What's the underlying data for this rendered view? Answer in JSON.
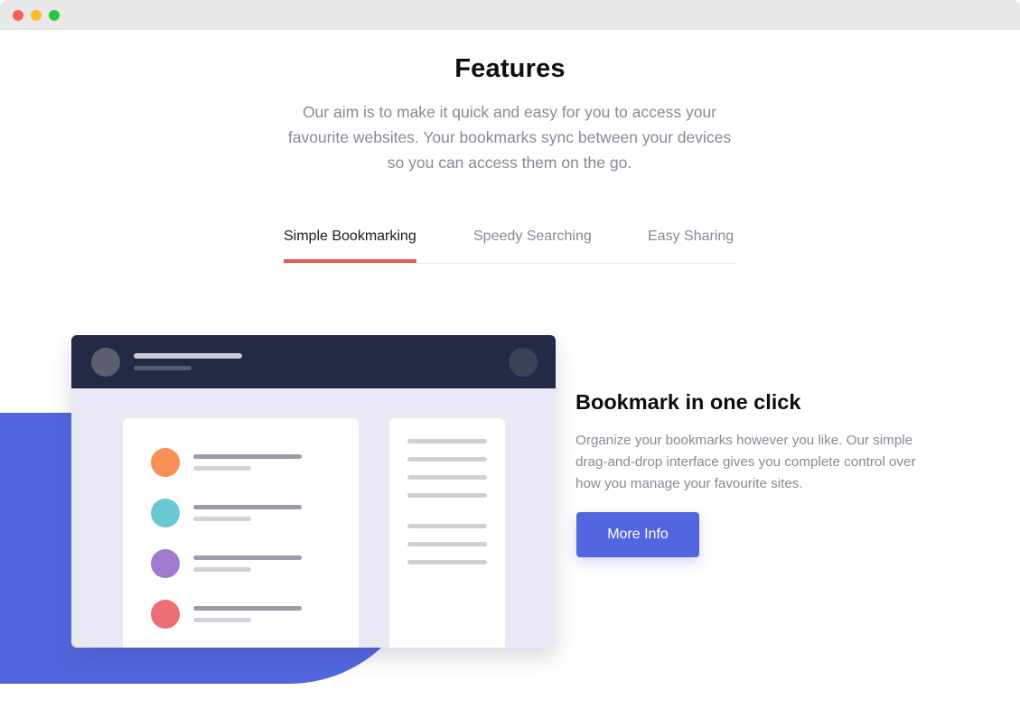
{
  "window": {
    "controls": [
      "close",
      "minimize",
      "maximize"
    ]
  },
  "features": {
    "title": "Features",
    "intro": "Our aim is to make it quick and easy for you to access your favourite websites. Your bookmarks sync between your devices so you can access them on the go."
  },
  "tabs": [
    {
      "label": "Simple Bookmarking",
      "active": true
    },
    {
      "label": "Speedy Searching",
      "active": false
    },
    {
      "label": "Easy Sharing",
      "active": false
    }
  ],
  "panel": {
    "title": "Bookmark in one click",
    "description": "Organize your bookmarks however you like. Our simple drag-and-drop interface gives you complete control over how you manage your favourite sites.",
    "button_label": "More Info"
  },
  "illustration": {
    "bookmark_colors": [
      "#f98f58",
      "#6bc8d3",
      "#a17ad1",
      "#ec6f73"
    ]
  },
  "colors": {
    "accent": "#5267df",
    "active_tab_underline": "#e25c5c",
    "dark_header": "#242a45"
  }
}
